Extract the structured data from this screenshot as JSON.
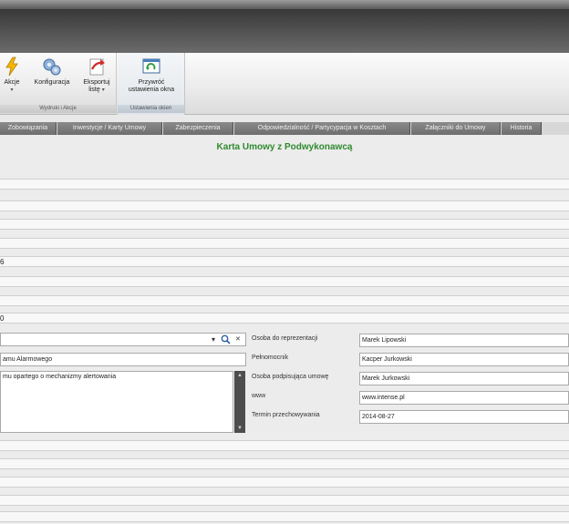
{
  "ribbon": {
    "group1": {
      "label": "Wydruki i Akcje",
      "buttons": [
        {
          "label": "Akcje",
          "dropdown": "▾"
        },
        {
          "label": "Konfiguracja"
        },
        {
          "label": "Eksportuj",
          "label2": "listę",
          "dropdown": "▾"
        }
      ]
    },
    "group2": {
      "label": "Ustawienia okien",
      "button": {
        "label": "Przywróć",
        "label2": "ustawienia okna"
      }
    }
  },
  "tabs": [
    "Zobowiązania",
    "Inwestycje / Karty Umowy",
    "Zabezpieczenia",
    "Odpowiedzialność / Partycypacja w Kosztach",
    "Załączniki do Umowy",
    "Historia"
  ],
  "form": {
    "title": "Karta Umowy z Podwykonawcą",
    "row_value_1": "6",
    "row_value_2": "0",
    "combo_value": "",
    "subject": "amu Alarmowego",
    "description": "mu opartego o mechanizmy alertowania",
    "right": {
      "representative_label": "Osoba do reprezentacji",
      "representative_value": "Marek Lipowski",
      "attorney_label": "Pełnomocnik",
      "attorney_value": "Kacper Jurkowski",
      "signer_label": "Osoba podpisująca umowę",
      "signer_value": "Marek Jurkowski",
      "www_label": "www",
      "www_value": "www.intense.pl",
      "storage_label": "Termin przechowywania",
      "storage_value": "2014-08-27"
    }
  },
  "colors": {
    "title_green": "#2f8a2f",
    "tab_gray": "#7a7a7a",
    "titlebar_dark": "#3a3a3a"
  }
}
